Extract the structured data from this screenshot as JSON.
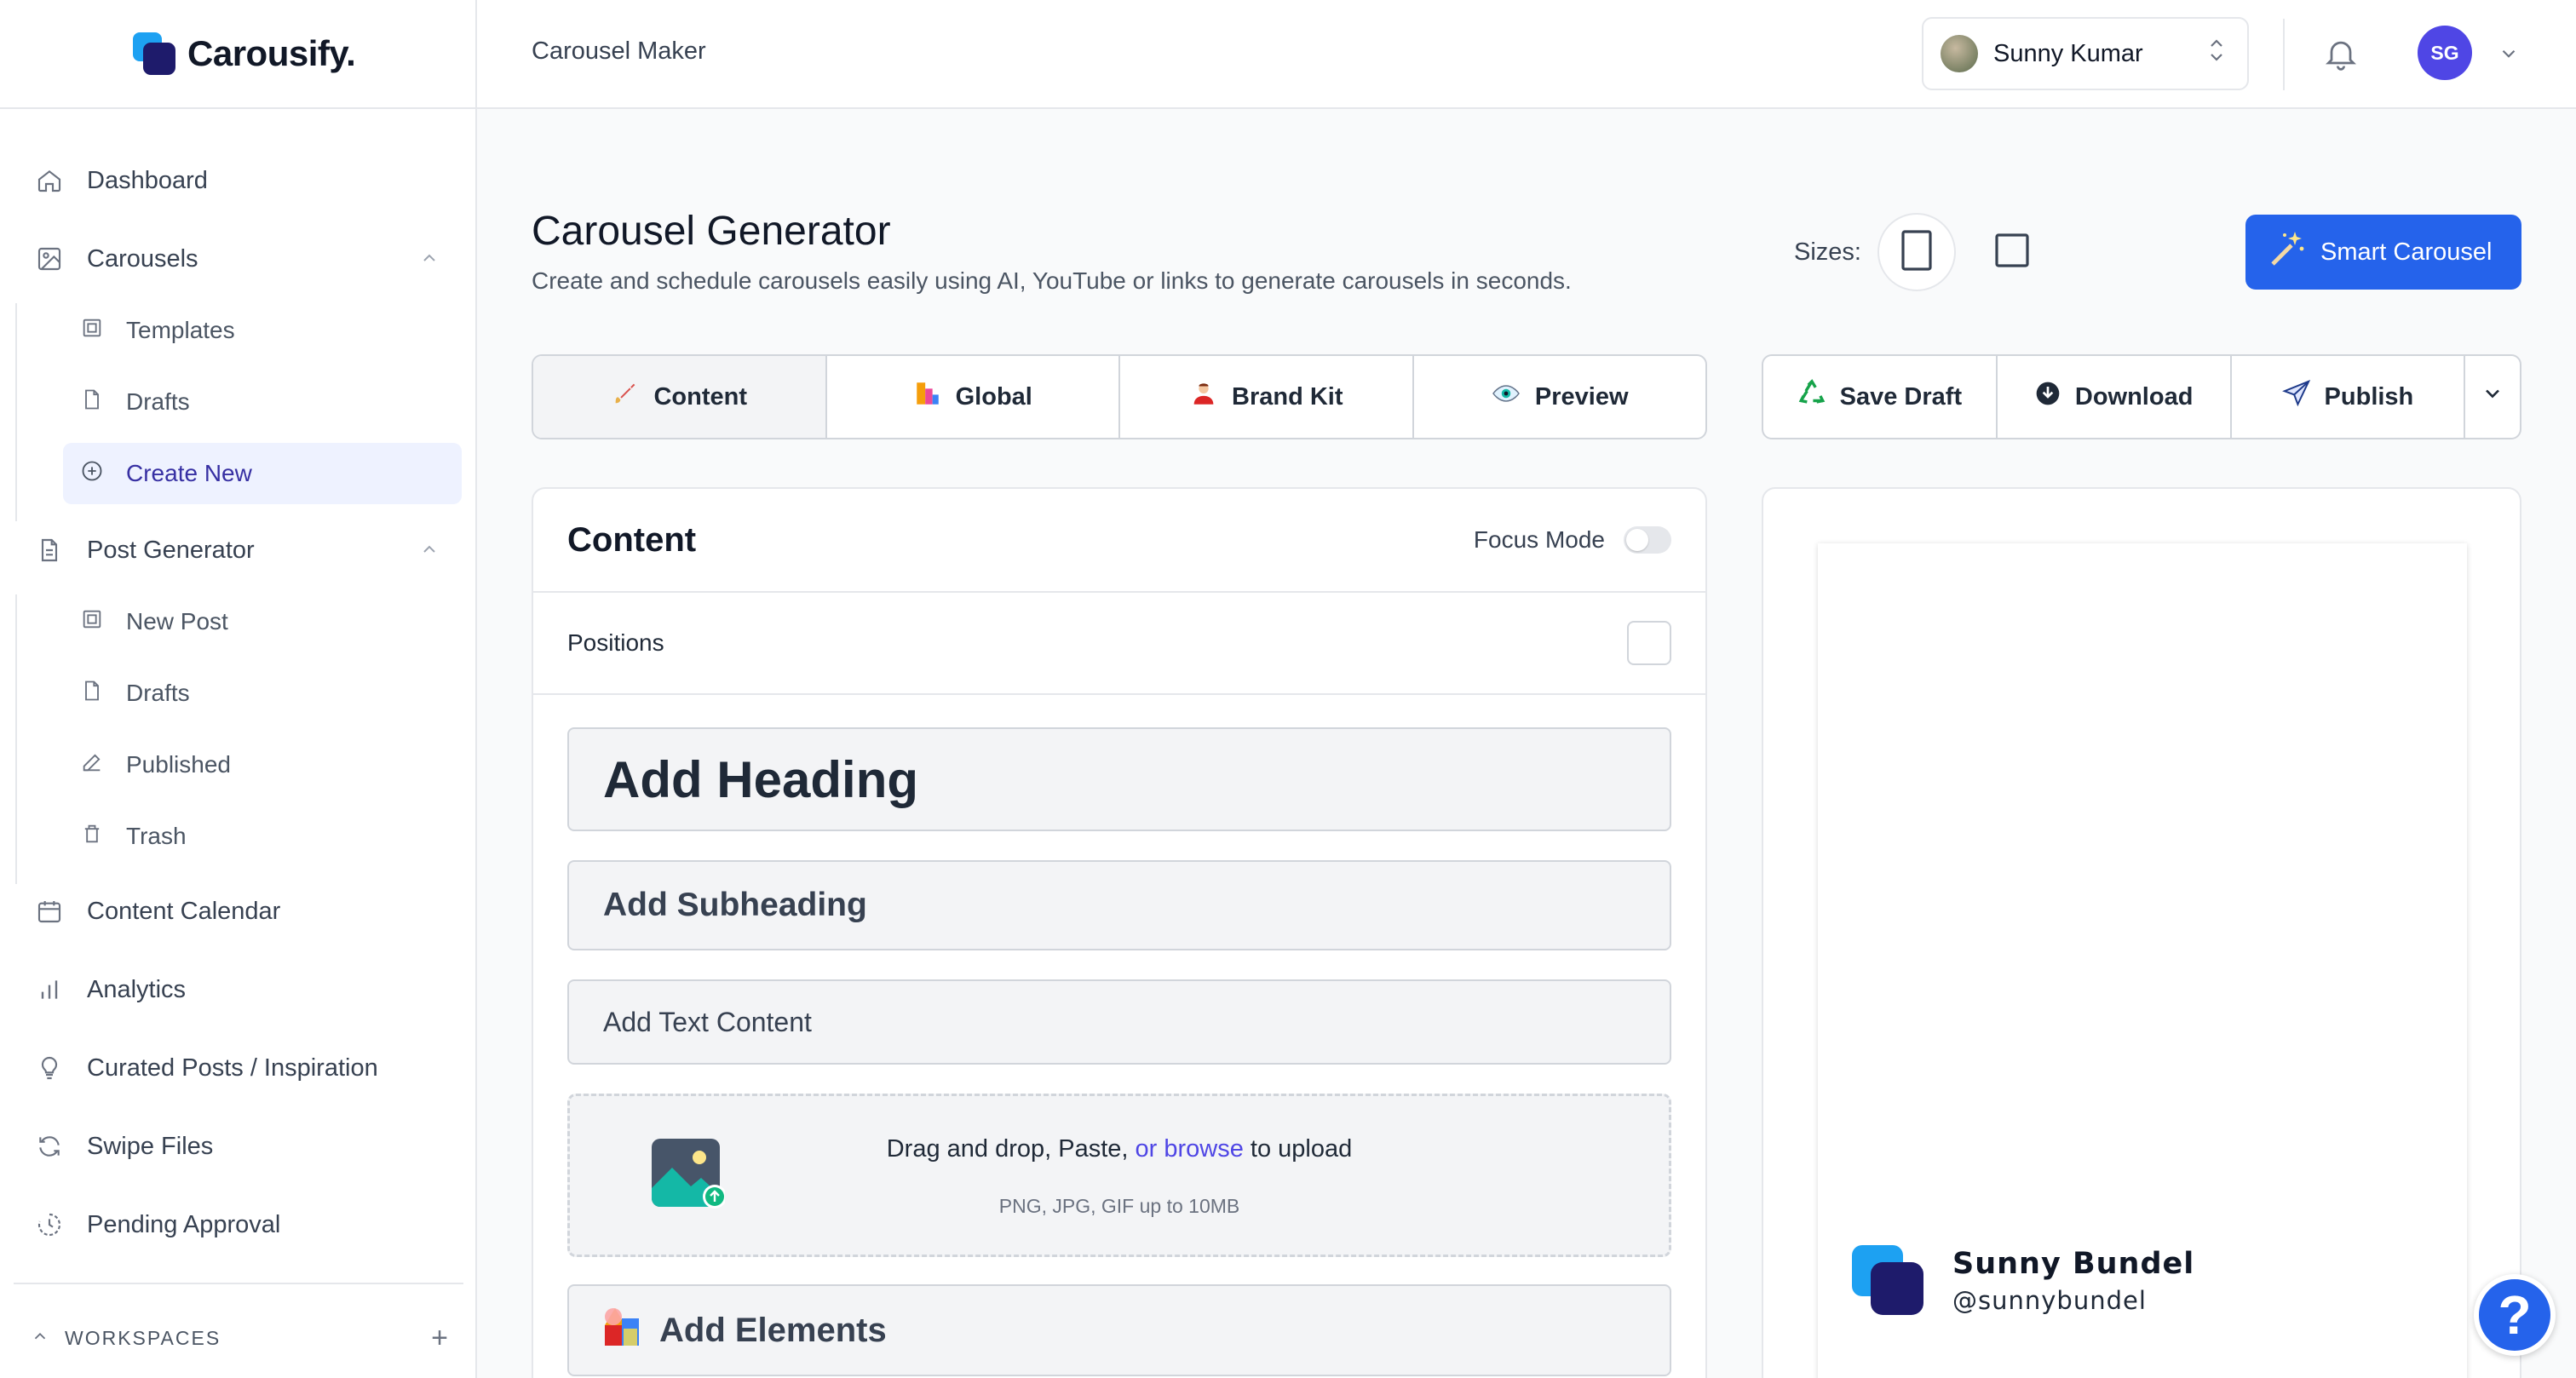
{
  "app": {
    "name": "Carousify."
  },
  "header": {
    "breadcrumb": "Carousel Maker",
    "user_name": "Sunny Kumar",
    "avatar_initials": "SG"
  },
  "sidebar": {
    "dashboard": "Dashboard",
    "carousels": "Carousels",
    "carousels_sub": [
      "Templates",
      "Drafts",
      "Create New"
    ],
    "post_generator": "Post Generator",
    "post_sub": [
      "New Post",
      "Drafts",
      "Published",
      "Trash"
    ],
    "content_calendar": "Content Calendar",
    "analytics": "Analytics",
    "curated": "Curated Posts / Inspiration",
    "swipe_files": "Swipe Files",
    "pending_approval": "Pending Approval",
    "workspaces": "WORKSPACES"
  },
  "main": {
    "title": "Carousel Generator",
    "subtitle": "Create and schedule carousels easily using AI, YouTube or links to generate carousels in seconds.",
    "sizes_label": "Sizes:",
    "smart_button": "Smart Carousel",
    "tabs": [
      "Content",
      "Global",
      "Brand Kit",
      "Preview"
    ],
    "actions": [
      "Save Draft",
      "Download",
      "Publish"
    ]
  },
  "content_panel": {
    "title": "Content",
    "focus_mode": "Focus Mode",
    "positions": "Positions",
    "heading_placeholder": "Add Heading",
    "subheading_placeholder": "Add Subheading",
    "text_placeholder": "Add Text Content",
    "upload_text_1": "Drag and drop, Paste, ",
    "upload_link": "or browse",
    "upload_text_2": " to upload",
    "upload_note": "PNG, JPG, GIF up to 10MB",
    "add_elements": "Add Elements"
  },
  "preview": {
    "brand_name": "Sunny Bundel",
    "brand_handle": "@sunnybundel"
  },
  "help": {
    "label": "?"
  },
  "colors": {
    "primary": "#2563eb",
    "accent": "#4f46e5",
    "brand_light": "#1da1f2",
    "brand_dark": "#1e1b6b"
  }
}
